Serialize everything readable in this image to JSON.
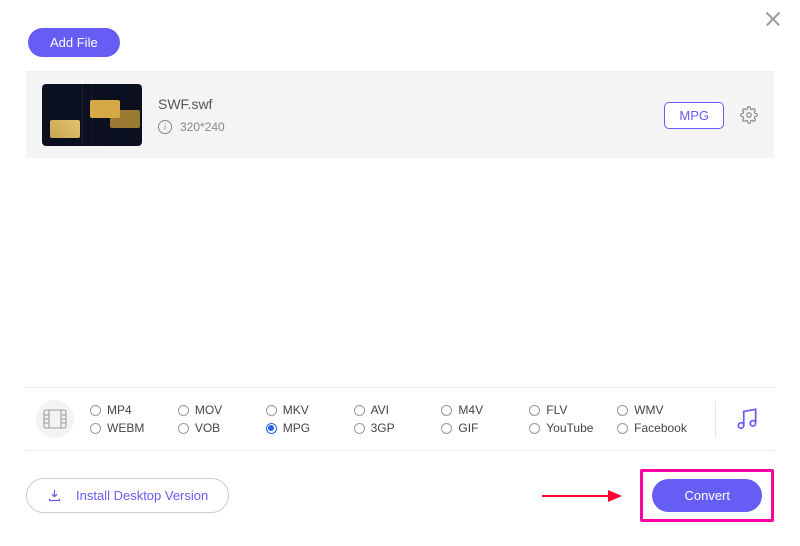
{
  "header": {
    "add_file_label": "Add File"
  },
  "file": {
    "name": "SWF.swf",
    "resolution": "320*240",
    "output_format": "MPG"
  },
  "formats": [
    {
      "label": "MP4",
      "selected": false
    },
    {
      "label": "MOV",
      "selected": false
    },
    {
      "label": "MKV",
      "selected": false
    },
    {
      "label": "AVI",
      "selected": false
    },
    {
      "label": "M4V",
      "selected": false
    },
    {
      "label": "FLV",
      "selected": false
    },
    {
      "label": "WMV",
      "selected": false
    },
    {
      "label": "WEBM",
      "selected": false
    },
    {
      "label": "VOB",
      "selected": false
    },
    {
      "label": "MPG",
      "selected": true
    },
    {
      "label": "3GP",
      "selected": false
    },
    {
      "label": "GIF",
      "selected": false
    },
    {
      "label": "YouTube",
      "selected": false
    },
    {
      "label": "Facebook",
      "selected": false
    }
  ],
  "actions": {
    "install_desktop_label": "Install Desktop Version",
    "convert_label": "Convert"
  }
}
